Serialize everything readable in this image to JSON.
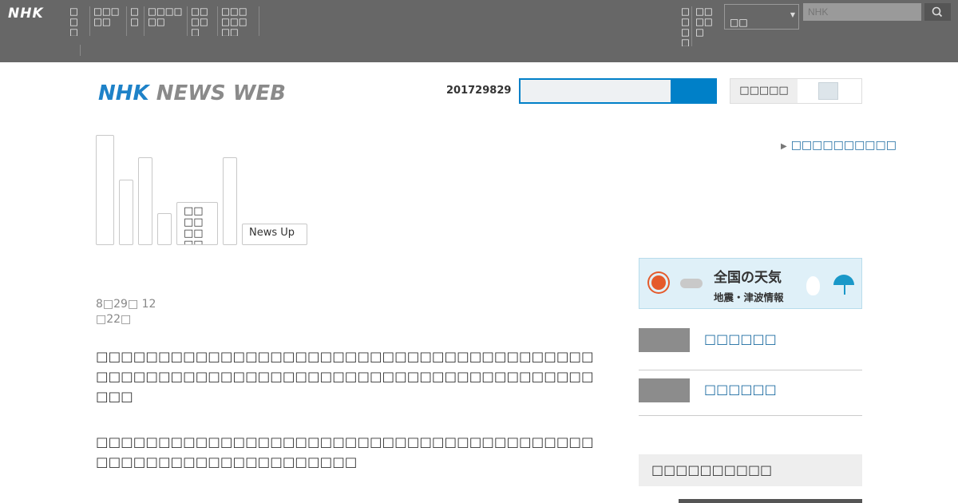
{
  "topbar": {
    "logo": "NHK",
    "nav": [
      "□□□□",
      "□□□□□",
      "□□",
      "□□□□□□",
      "□□□□□",
      "□□□□□□□□"
    ],
    "nav_right": [
      "□□□□",
      "□□□□□"
    ],
    "language": "□□",
    "search_placeholder": "NHK"
  },
  "header": {
    "brand_nhk": "NHK",
    "brand_news": "NEWS WEB",
    "date": "201729829",
    "text_size_label": "□□□□□"
  },
  "categories": {
    "tabs": [
      "",
      "",
      "",
      "",
      "□□□□□□□□□□",
      "",
      "News Up"
    ],
    "sub_link": "□□□□□□□□□□"
  },
  "article": {
    "date_line1": "8□29□ 12",
    "date_line2": "□22□",
    "paragraph1": "□□□□□□□□□□□□□□□□□□□□□□□□□□□□□□□□□□□□□□□□□□□□□□□□□□□□□□□□□□□□□□□□□□□□□□□□□□□□□□□□□□□",
    "paragraph2": "□□□□□□□□□□□□□□□□□□□□□□□□□□□□□□□□□□□□□□□□□□□□□□□□□□□□□□□□□□□□□"
  },
  "sidebar": {
    "weather_title": "全国の天気",
    "weather_sub": "地震・津波情報",
    "items": [
      {
        "label": "□□□□□□"
      },
      {
        "label": "□□□□□□"
      }
    ],
    "heading": "□□□□□□□□□□"
  },
  "colors": {
    "topbar": "#676767",
    "brand_blue": "#1e82c8",
    "link": "#1a6aa0",
    "search_accent": "#0080c8"
  }
}
